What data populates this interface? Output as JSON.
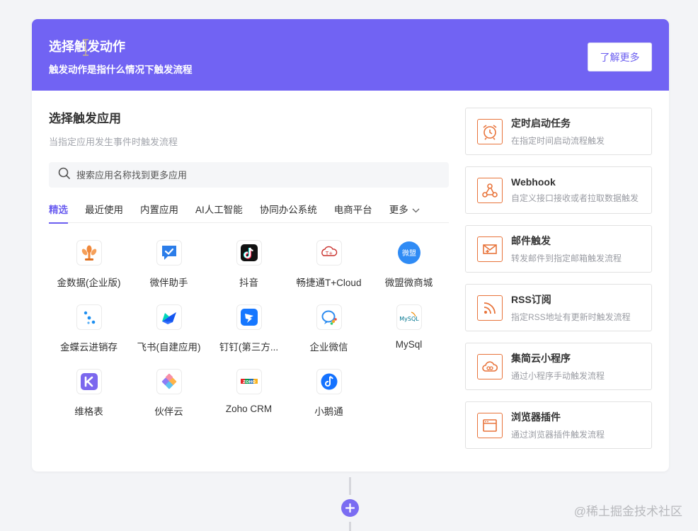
{
  "header": {
    "title": "选择触发动作",
    "subtitle": "触发动作是指什么情况下触发流程",
    "learn_more": "了解更多"
  },
  "app_section": {
    "title": "选择触发应用",
    "subtitle": "当指定应用发生事件时触发流程",
    "search_placeholder": "搜索应用名称找到更多应用"
  },
  "tabs": [
    {
      "label": "精选",
      "active": true
    },
    {
      "label": "最近使用"
    },
    {
      "label": "内置应用"
    },
    {
      "label": "AI人工智能"
    },
    {
      "label": "协同办公系统"
    },
    {
      "label": "电商平台"
    },
    {
      "label": "更多"
    }
  ],
  "apps": [
    {
      "name": "金数据(企业版)",
      "icon": "jinshuju-icon"
    },
    {
      "name": "微伴助手",
      "icon": "weiban-icon"
    },
    {
      "name": "抖音",
      "icon": "douyin-icon"
    },
    {
      "name": "畅捷通T+Cloud",
      "icon": "chanjet-icon"
    },
    {
      "name": "微盟微商城",
      "icon": "weimob-icon",
      "icon_text": "微盟"
    },
    {
      "name": "金蝶云进销存",
      "icon": "kingdee-icon"
    },
    {
      "name": "飞书(自建应用)",
      "icon": "feishu-icon"
    },
    {
      "name": "钉钉(第三方...",
      "icon": "dingtalk-icon"
    },
    {
      "name": "企业微信",
      "icon": "wecom-icon"
    },
    {
      "name": "MySql",
      "icon": "mysql-icon",
      "icon_text": "MySQL"
    },
    {
      "name": "维格表",
      "icon": "vika-icon"
    },
    {
      "name": "伙伴云",
      "icon": "huoban-icon"
    },
    {
      "name": "Zoho CRM",
      "icon": "zoho-icon",
      "icon_text": "ZOHO"
    },
    {
      "name": "小鹅通",
      "icon": "xiaoe-icon"
    }
  ],
  "triggers": [
    {
      "title": "定时启动任务",
      "desc": "在指定时间启动流程触发",
      "icon": "alarm-clock-icon"
    },
    {
      "title": "Webhook",
      "desc": "自定义接口接收或者拉取数据触发",
      "icon": "webhook-icon"
    },
    {
      "title": "邮件触发",
      "desc": "转发邮件到指定邮箱触发流程",
      "icon": "mail-icon"
    },
    {
      "title": "RSS订阅",
      "desc": "指定RSS地址有更新时触发流程",
      "icon": "rss-icon"
    },
    {
      "title": "集简云小程序",
      "desc": "通过小程序手动触发流程",
      "icon": "cloud-icon"
    },
    {
      "title": "浏览器插件",
      "desc": "通过浏览器插件触发流程",
      "icon": "browser-icon"
    }
  ],
  "watermark": "@稀土掘金技术社区",
  "colors": {
    "accent": "#7163f3",
    "trigger_icon": "#e8743b"
  }
}
